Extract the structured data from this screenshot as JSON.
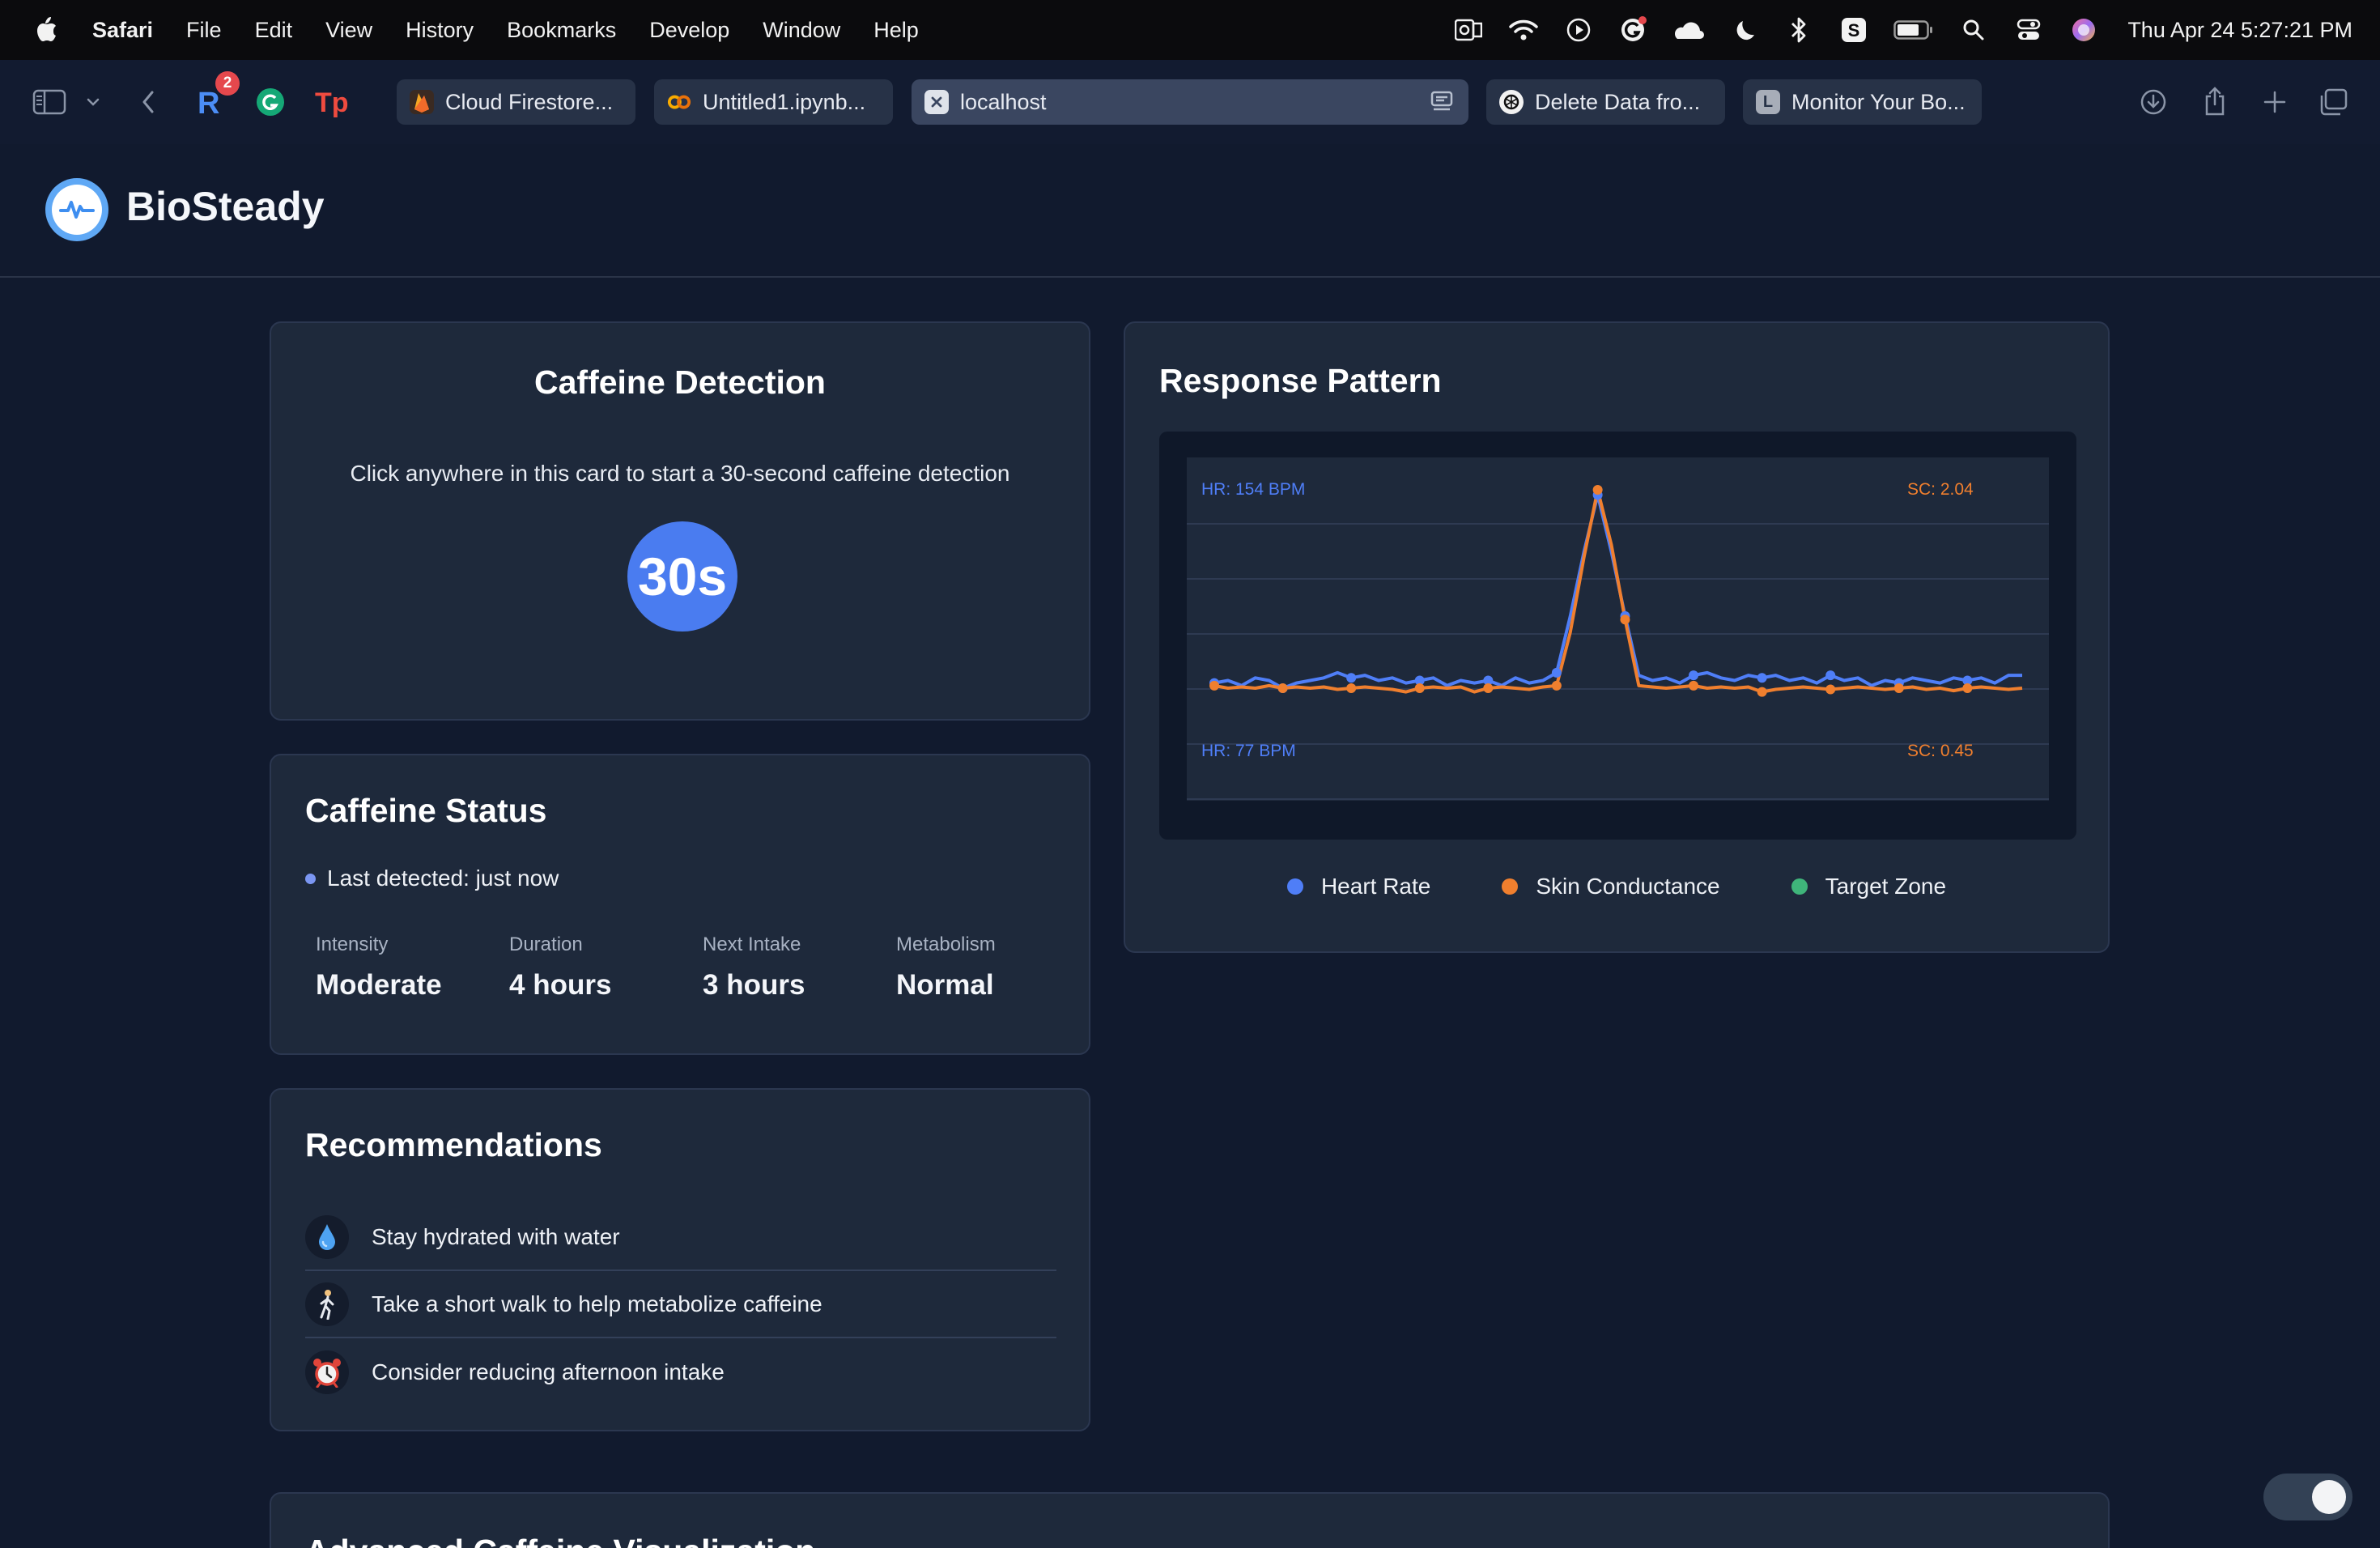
{
  "menubar": {
    "app": "Safari",
    "items": [
      "File",
      "Edit",
      "View",
      "History",
      "Bookmarks",
      "Develop",
      "Window",
      "Help"
    ],
    "clock": "Thu Apr 24  5:27:21 PM"
  },
  "browser": {
    "extension_badge": "2",
    "tabs": [
      {
        "label": "Cloud Firestore...",
        "icon": "firebase-icon"
      },
      {
        "label": "Untitled1.ipynb...",
        "icon": "colab-icon"
      },
      {
        "label": "localhost",
        "icon": "close-icon"
      },
      {
        "label": "Delete Data fro...",
        "icon": "openai-icon"
      },
      {
        "label": "Monitor Your Bo...",
        "icon": "letter-l-icon"
      }
    ],
    "favicon_letter": "L"
  },
  "app": {
    "title": "BioSteady"
  },
  "detection": {
    "title": "Caffeine Detection",
    "subtitle": "Click anywhere in this card to start a 30-second caffeine detection",
    "timer": "30s"
  },
  "status": {
    "title": "Caffeine Status",
    "last_detected": "Last detected: just now",
    "metrics": [
      {
        "label": "Intensity",
        "value": "Moderate"
      },
      {
        "label": "Duration",
        "value": "4 hours"
      },
      {
        "label": "Next Intake",
        "value": "3 hours"
      },
      {
        "label": "Metabolism",
        "value": "Normal"
      }
    ]
  },
  "recommendations": {
    "title": "Recommendations",
    "items": [
      {
        "icon": "water-drop-icon",
        "text": "Stay hydrated with water"
      },
      {
        "icon": "walking-person-icon",
        "text": "Take a short walk to help metabolize caffeine"
      },
      {
        "icon": "alarm-clock-icon",
        "text": "Consider reducing afternoon intake"
      }
    ]
  },
  "response": {
    "title": "Response Pattern",
    "hr_max_label": "HR: 154 BPM",
    "hr_min_label": "HR: 77 BPM",
    "sc_max_label": "SC: 2.04",
    "sc_min_label": "SC: 0.45",
    "legend": [
      {
        "label": "Heart Rate",
        "color": "#4f7ef7"
      },
      {
        "label": "Skin Conductance",
        "color": "#f07f2e"
      },
      {
        "label": "Target Zone",
        "color": "#3fb47a"
      }
    ]
  },
  "advanced": {
    "title": "Advanced Caffeine Visualization"
  },
  "chart_data": {
    "type": "line",
    "title": "Response Pattern",
    "x": [
      0,
      1,
      2,
      3,
      4,
      5,
      6,
      7,
      8,
      9,
      10,
      11,
      12,
      13,
      14,
      15,
      16,
      17,
      18,
      19,
      20,
      21,
      22,
      23,
      24,
      25,
      26,
      27,
      28,
      29,
      30,
      31,
      32,
      33,
      34,
      35,
      36,
      37,
      38,
      39,
      40,
      41,
      42,
      43,
      44,
      45,
      46,
      47,
      48,
      49,
      50,
      51,
      52,
      53,
      54,
      55,
      56,
      57,
      58,
      59
    ],
    "series": [
      {
        "name": "Heart Rate",
        "color": "#4f7ef7",
        "values": [
          79,
          80,
          78,
          81,
          80,
          77,
          79,
          80,
          81,
          83,
          81,
          82,
          80,
          81,
          79,
          80,
          81,
          78,
          80,
          79,
          80,
          78,
          81,
          79,
          80,
          83,
          105,
          130,
          152,
          130,
          105,
          82,
          80,
          81,
          79,
          82,
          83,
          81,
          80,
          82,
          81,
          82,
          80,
          81,
          79,
          82,
          80,
          81,
          78,
          80,
          79,
          81,
          80,
          79,
          81,
          80,
          81,
          79,
          82,
          82
        ]
      },
      {
        "name": "Skin Conductance",
        "color": "#f07f2e",
        "values": [
          0.47,
          0.45,
          0.46,
          0.45,
          0.47,
          0.45,
          0.46,
          0.45,
          0.46,
          0.44,
          0.45,
          0.46,
          0.45,
          0.44,
          0.42,
          0.45,
          0.46,
          0.45,
          0.46,
          0.42,
          0.45,
          0.46,
          0.45,
          0.44,
          0.46,
          0.47,
          0.9,
          1.5,
          2.04,
          1.6,
          1.0,
          0.47,
          0.46,
          0.45,
          0.46,
          0.47,
          0.45,
          0.46,
          0.45,
          0.46,
          0.42,
          0.44,
          0.45,
          0.46,
          0.45,
          0.44,
          0.45,
          0.46,
          0.45,
          0.44,
          0.45,
          0.46,
          0.44,
          0.45,
          0.43,
          0.45,
          0.46,
          0.45,
          0.44,
          0.45
        ]
      }
    ],
    "hr_range": [
      77,
      154
    ],
    "sc_range": [
      0.45,
      2.04
    ],
    "grid": true
  }
}
